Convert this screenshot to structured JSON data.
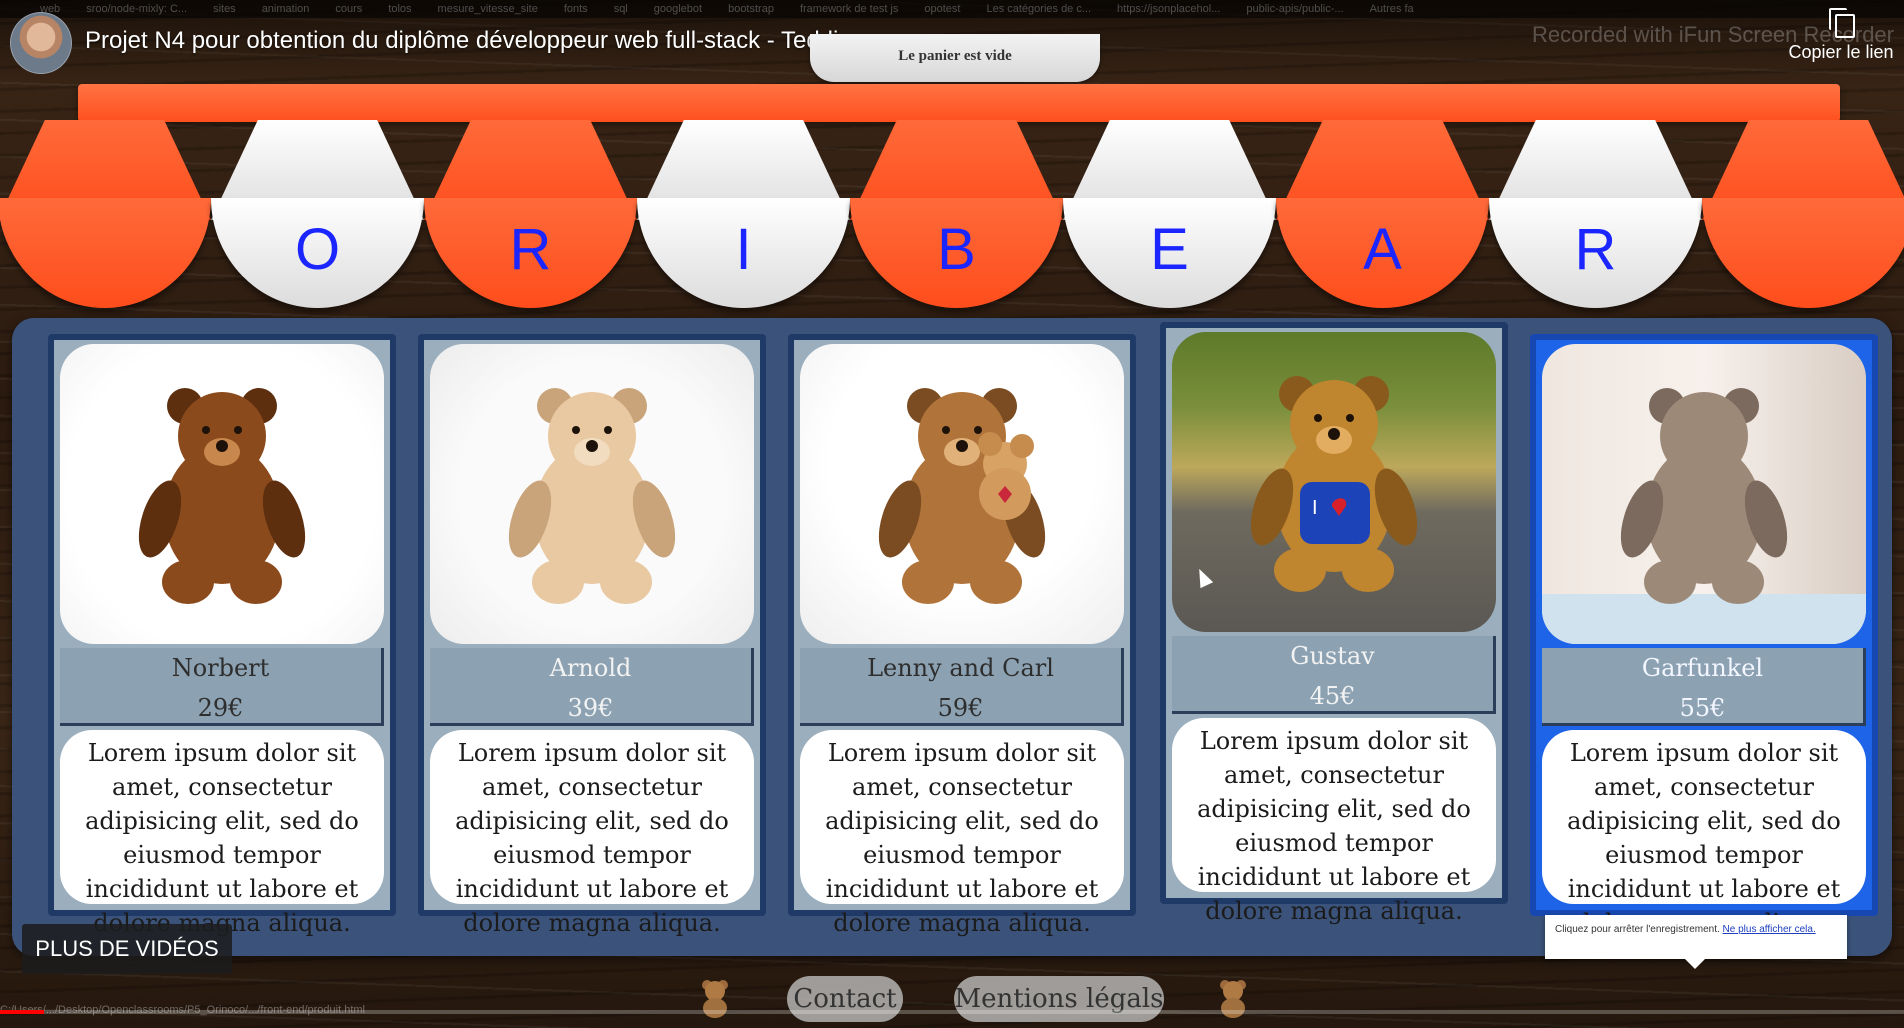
{
  "bookmarks": [
    "web",
    "sroo/node-mixly: C...",
    "sites",
    "animation",
    "cours",
    "tolos",
    "mesure_vitesse_site",
    "fonts",
    "sql",
    "googlebot",
    "bootstrap",
    "framework de test js",
    "opotest",
    "Les catégories de c...",
    "https://jsonplacehol...",
    "public-apis/public-...",
    "Autres fa"
  ],
  "video": {
    "title": "Projet N4 pour obtention du diplôme développeur web full-stack - Teddies",
    "watermark": "Recorded with iFun Screen Recorder",
    "copy_link_label": "Copier le lien",
    "more_videos_label": "PLUS DE VIDÉOS",
    "progress": 0.023
  },
  "cart": {
    "status": "Le panier est vide"
  },
  "brand": {
    "letters": [
      "O",
      "R",
      "I",
      "B",
      "E",
      "A",
      "R"
    ],
    "letter_color": "#1a25ff",
    "stripe_colors": [
      "#ff5a28",
      "#ffffff"
    ]
  },
  "products": [
    {
      "name": "Norbert",
      "price": "29€",
      "description": "Lorem ipsum dolor sit amet, consectetur adipisicing elit, sed do eiusmod tempor incididunt ut labore et dolore magna aliqua.",
      "image": "brown-teddy-bear-photo"
    },
    {
      "name": "Arnold",
      "price": "39€",
      "description": "Lorem ipsum dolor sit amet, consectetur adipisicing elit, sed do eiusmod tempor incididunt ut labore et dolore magna aliqua.",
      "image": "beige-teddy-bear-photo"
    },
    {
      "name": "Lenny and Carl",
      "price": "59€",
      "description": "Lorem ipsum dolor sit amet, consectetur adipisicing elit, sed do eiusmod tempor incididunt ut labore et dolore magna aliqua.",
      "image": "two-teddy-bears-photo"
    },
    {
      "name": "Gustav",
      "price": "45€",
      "description": "Lorem ipsum dolor sit amet, consectetur adipisicing elit, sed do eiusmod tempor incididunt ut labore et dolore magna aliqua.",
      "image": "teddy-bear-blue-shirt-photo"
    },
    {
      "name": "Garfunkel",
      "price": "55€",
      "description": "Lorem ipsum dolor sit amet, consectetur adipisicing elit, sed do eiusmod tempor incididunt ut labore et dolore magna aliqua.",
      "image": "teddy-bear-window-photo"
    }
  ],
  "recording_tooltip": {
    "text": "Cliquez pour arrêter l'enregistrement.",
    "link": "Ne plus afficher cela."
  },
  "footer": {
    "contact_label": "Contact",
    "legal_label": "Mentions légals"
  },
  "status_url": "C:/Users/.../Desktop/Openclassrooms/P5_Orinoco/.../front-end/produit.html"
}
